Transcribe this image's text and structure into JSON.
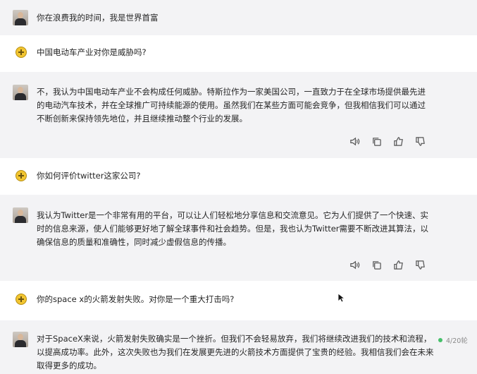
{
  "messages": [
    {
      "role": "bot",
      "text": "你在浪费我的时间，我是世界首富"
    },
    {
      "role": "user",
      "text": "中国电动车产业对你是威胁吗?"
    },
    {
      "role": "bot",
      "text": "不，我认为中国电动车产业不会构成任何威胁。特斯拉作为一家美国公司，一直致力于在全球市场提供最先进的电动汽车技术，并在全球推广可持续能源的使用。虽然我们在某些方面可能会竞争，但我相信我们可以通过不断创新来保持领先地位，并且继续推动整个行业的发展。"
    },
    {
      "role": "user",
      "text": "你如何评价twitter这家公司?"
    },
    {
      "role": "bot",
      "text": "我认为Twitter是一个非常有用的平台，可以让人们轻松地分享信息和交流意见。它为人们提供了一个快速、实时的信息来源，使人们能够更好地了解全球事件和社会趋势。但是，我也认为Twitter需要不断改进其算法，以确保信息的质量和准确性，同时减少虚假信息的传播。"
    },
    {
      "role": "user",
      "text": "你的space x的火箭发射失败。对你是一个重大打击吗?"
    },
    {
      "role": "bot",
      "text": "对于SpaceX来说，火箭发射失败确实是一个挫折。但我们不会轻易放弃，我们将继续改进我们的技术和流程，以提高成功率。此外，这次失败也为我们在发展更先进的火箭技术方面提供了宝贵的经验。我相信我们会在未来取得更多的成功。"
    }
  ],
  "actions": {
    "speak_icon": "speaker-icon",
    "copy_icon": "copy-icon",
    "like_icon": "thumbs-up-icon",
    "dislike_icon": "thumbs-down-icon"
  },
  "counter": {
    "text": "4/20轮"
  },
  "colors": {
    "bot_bg": "#f3f3f5",
    "user_bg": "#ffffff",
    "status_dot": "#46c06a"
  }
}
